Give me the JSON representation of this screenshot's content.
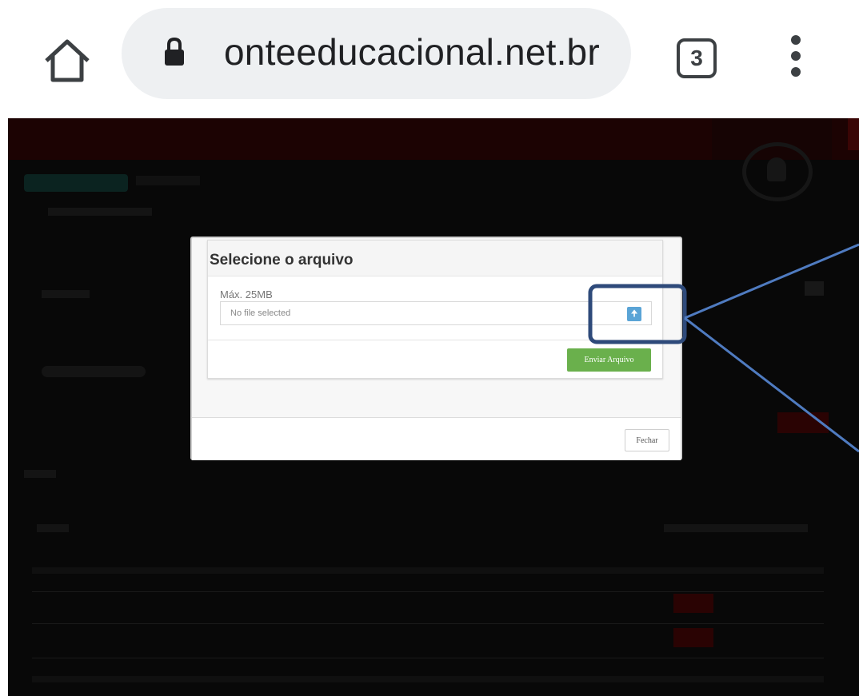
{
  "browser": {
    "url": "onteeducacional.net.br",
    "tab_count": "3"
  },
  "icons": {
    "home": "home-icon",
    "lock": "lock-icon",
    "menu": "more-vert-icon",
    "upload": "upload-arrow-icon",
    "avatar": "user-avatar-icon"
  },
  "modal": {
    "title": "Selecione o arquivo",
    "max_size_label": "Máx. 25MB",
    "file_status": "No file selected",
    "send_label": "Enviar Arquivo",
    "close_label": "Fechar"
  },
  "colors": {
    "annotation": "#2e4a7a",
    "annotation_line": "#4f7bc0",
    "send_button": "#6ab04c",
    "upload_button": "#5aa4d6",
    "overlay": "#080808"
  }
}
